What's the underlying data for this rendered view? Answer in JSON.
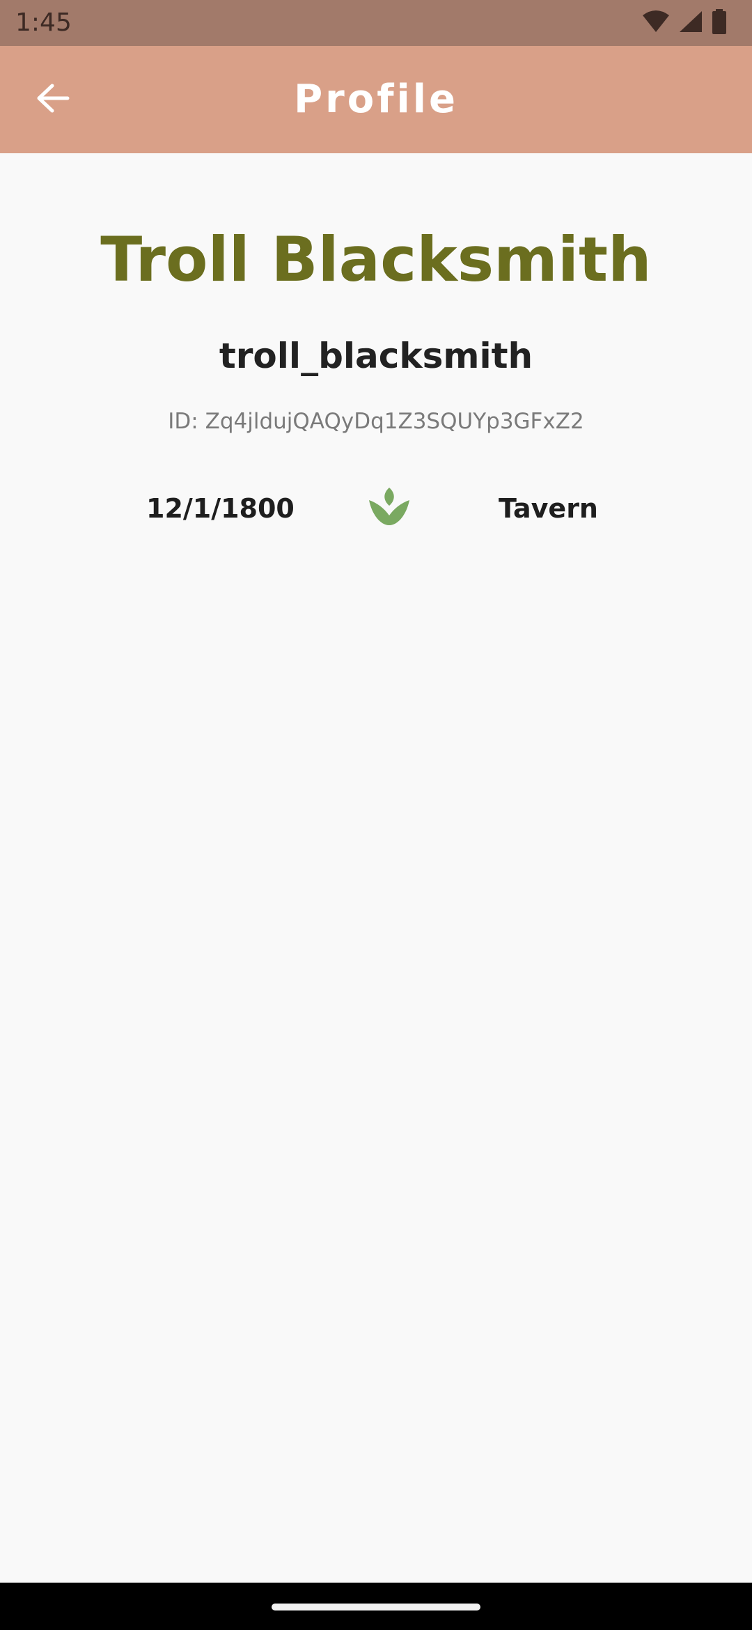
{
  "status_bar": {
    "time": "1:45",
    "icons": [
      "wifi-icon",
      "cellular-signal-icon",
      "battery-icon"
    ]
  },
  "app_bar": {
    "title": "Profile",
    "back_icon": "arrow-left-icon",
    "background_color": "#d9a088"
  },
  "profile": {
    "display_name": "Troll Blacksmith",
    "username": "troll_blacksmith",
    "id_text": "ID: Zq4jldujQAQyDq1Z3SQUYp3GFxZ2",
    "date": "12/1/1800",
    "icon": "leaf-sprout-icon",
    "place": "Tavern"
  },
  "colors": {
    "display_name": "#6b6e1f",
    "accent_icon": "#7aa961",
    "status_bar": "#a27a6a"
  }
}
